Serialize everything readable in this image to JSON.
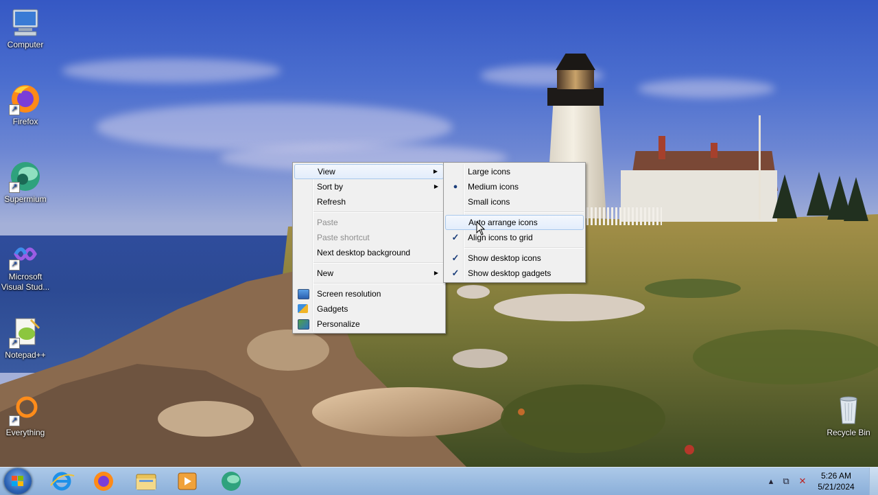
{
  "desktop": {
    "icons": [
      {
        "label": "Computer"
      },
      {
        "label": "Firefox"
      },
      {
        "label": "Supermium"
      },
      {
        "label": "Microsoft Visual Stud..."
      },
      {
        "label": "Notepad++"
      },
      {
        "label": "Everything"
      },
      {
        "label": "Recycle Bin"
      }
    ]
  },
  "context_menu": {
    "items": [
      {
        "label": "View"
      },
      {
        "label": "Sort by"
      },
      {
        "label": "Refresh"
      },
      {
        "label": "Paste"
      },
      {
        "label": "Paste shortcut"
      },
      {
        "label": "Next desktop background"
      },
      {
        "label": "New"
      },
      {
        "label": "Screen resolution"
      },
      {
        "label": "Gadgets"
      },
      {
        "label": "Personalize"
      }
    ]
  },
  "view_submenu": {
    "items": [
      {
        "label": "Large icons"
      },
      {
        "label": "Medium icons"
      },
      {
        "label": "Small icons"
      },
      {
        "label": "Auto arrange icons"
      },
      {
        "label": "Align icons to grid"
      },
      {
        "label": "Show desktop icons"
      },
      {
        "label": "Show desktop gadgets"
      }
    ]
  },
  "taskbar": {
    "clock": {
      "time": "5:26 AM",
      "date": "5/21/2024"
    }
  },
  "colors": {
    "taskbar": "#9fc0e4",
    "menu_bg": "#f0f0f0",
    "highlight_border": "#a8c8ec"
  }
}
